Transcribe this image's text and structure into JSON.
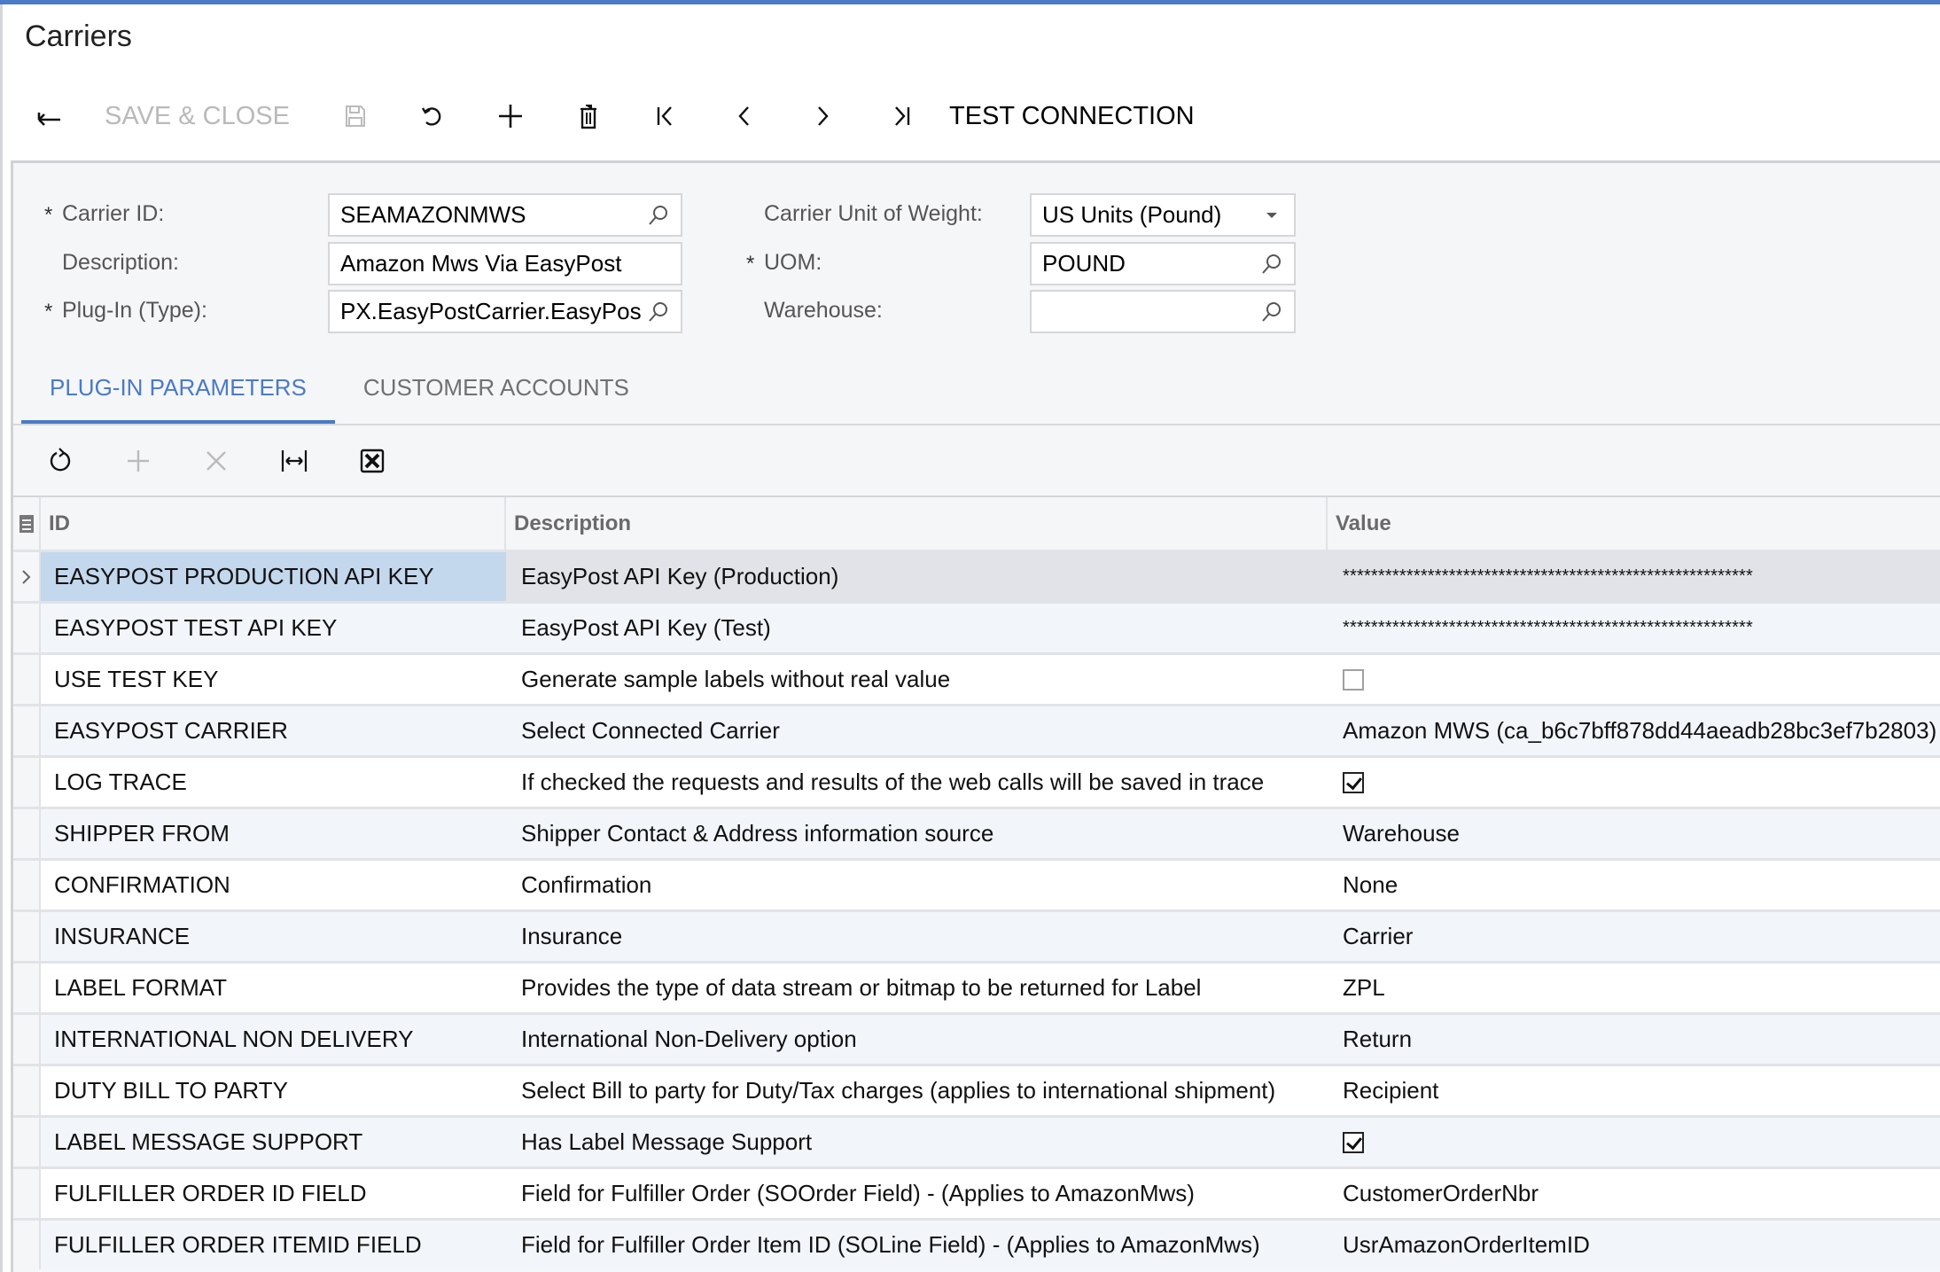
{
  "page": {
    "title": "Carriers"
  },
  "colors": {
    "accent": "#4a7ac8",
    "selected_id_cell": "#c3d7ed",
    "selected_row": "#e1e3e8",
    "alt_row": "#f2f5f9"
  },
  "toolbar": {
    "back_icon": "back-arrow-icon",
    "save_close_label": "SAVE & CLOSE",
    "save_icon": "save-icon",
    "undo_icon": "undo-icon",
    "add_icon": "plus-icon",
    "delete_icon": "trash-icon",
    "first_icon": "first-record-icon",
    "prev_icon": "previous-record-icon",
    "next_icon": "next-record-icon",
    "last_icon": "last-record-icon",
    "test_connection_label": "TEST CONNECTION"
  },
  "form": {
    "carrier_id": {
      "label": "Carrier ID:",
      "required": "*",
      "value": "SEAMAZONMWS"
    },
    "description": {
      "label": "Description:",
      "value": "Amazon Mws Via EasyPost"
    },
    "plugin_type": {
      "label": "Plug-In (Type):",
      "required": "*",
      "value": "PX.EasyPostCarrier.EasyPos"
    },
    "unit_of_weight": {
      "label": "Carrier Unit of Weight:",
      "value": "US Units (Pound)"
    },
    "uom": {
      "label": "UOM:",
      "required": "*",
      "value": "POUND"
    },
    "warehouse": {
      "label": "Warehouse:",
      "value": ""
    }
  },
  "tabs": [
    {
      "label": "PLUG-IN PARAMETERS",
      "active": true
    },
    {
      "label": "CUSTOMER ACCOUNTS",
      "active": false
    }
  ],
  "grid": {
    "toolbar": [
      "refresh-icon",
      "add-row-icon",
      "delete-row-icon",
      "fit-columns-icon",
      "export-excel-icon"
    ],
    "columns": {
      "id": "ID",
      "description": "Description",
      "value": "Value"
    },
    "rows": [
      {
        "id": "EASYPOST PRODUCTION API KEY",
        "description": "EasyPost API Key (Production)",
        "value": "**********************************************************",
        "type": "masked",
        "selected": true
      },
      {
        "id": "EASYPOST TEST API KEY",
        "description": "EasyPost API Key (Test)",
        "value": "**********************************************************",
        "type": "masked"
      },
      {
        "id": "USE TEST KEY",
        "description": "Generate sample labels without real value",
        "value": false,
        "type": "checkbox"
      },
      {
        "id": "EASYPOST CARRIER",
        "description": "Select Connected Carrier",
        "value": "Amazon MWS (ca_b6c7bff878dd44aeadb28bc3ef7b2803)",
        "type": "text"
      },
      {
        "id": "LOG TRACE",
        "description": "If checked the requests and results of the web calls will be saved in trace",
        "value": true,
        "type": "checkbox"
      },
      {
        "id": "SHIPPER FROM",
        "description": "Shipper Contact & Address information source",
        "value": "Warehouse",
        "type": "text"
      },
      {
        "id": "CONFIRMATION",
        "description": "Confirmation",
        "value": "None",
        "type": "text"
      },
      {
        "id": "INSURANCE",
        "description": "Insurance",
        "value": "Carrier",
        "type": "text"
      },
      {
        "id": "LABEL FORMAT",
        "description": "Provides the type of data stream or bitmap to be returned for Label",
        "value": "ZPL",
        "type": "text"
      },
      {
        "id": "INTERNATIONAL NON DELIVERY",
        "description": "International Non-Delivery option",
        "value": "Return",
        "type": "text"
      },
      {
        "id": "DUTY BILL TO PARTY",
        "description": "Select Bill to party for Duty/Tax charges (applies to international shipment)",
        "value": "Recipient",
        "type": "text"
      },
      {
        "id": "LABEL MESSAGE SUPPORT",
        "description": "Has Label Message Support",
        "value": true,
        "type": "checkbox"
      },
      {
        "id": "FULFILLER ORDER ID FIELD",
        "description": "Field for Fulfiller Order (SOOrder Field) - (Applies to AmazonMws)",
        "value": "CustomerOrderNbr",
        "type": "text"
      },
      {
        "id": "FULFILLER ORDER ITEMID FIELD",
        "description": "Field for Fulfiller Order Item ID (SOLine Field) - (Applies to AmazonMws)",
        "value": "UsrAmazonOrderItemID",
        "type": "text"
      }
    ]
  }
}
